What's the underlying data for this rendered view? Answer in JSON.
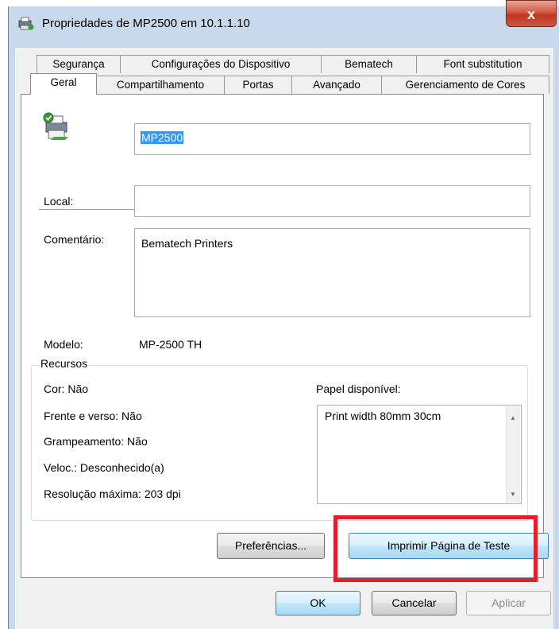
{
  "window": {
    "title": "Propriedades de MP2500 em 10.1.1.10",
    "close_label": "x"
  },
  "tabs_back": [
    "Segurança",
    "Configurações do Dispositivo",
    "Bematech",
    "Font substitution"
  ],
  "tabs_front": [
    "Geral",
    "Compartilhamento",
    "Portas",
    "Avançado",
    "Gerenciamento de Cores"
  ],
  "general": {
    "printer_name": "MP2500",
    "local_label": "Local:",
    "local_value": "",
    "comment_label": "Comentário:",
    "comment_value": "Bematech Printers",
    "model_label": "Modelo:",
    "model_value": "MP-2500 TH"
  },
  "features": {
    "group_label": "Recursos",
    "color": "Cor: Não",
    "duplex": "Frente e verso: Não",
    "staple": "Grampeamento: Não",
    "speed": "Veloc.: Desconhecido(a)",
    "resolution": "Resolução máxima: 203 dpi",
    "paper_label": "Papel disponível:",
    "paper_items": [
      "Print width 80mm 30cm"
    ]
  },
  "buttons": {
    "preferences": "Preferências...",
    "print_test": "Imprimir Página de Teste",
    "ok": "OK",
    "cancel": "Cancelar",
    "apply": "Aplicar"
  },
  "colors": {
    "highlight": "#e0202a",
    "title_bar": "#c9d9ec",
    "selection": "#3399ff"
  }
}
